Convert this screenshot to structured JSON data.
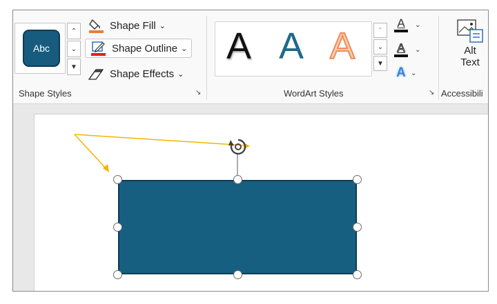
{
  "shape_styles": {
    "sample_label": "Abc",
    "shape_fill_label": "Shape Fill",
    "shape_outline_label": "Shape Outline",
    "shape_effects_label": "Shape Effects",
    "group_label": "Shape Styles"
  },
  "wordart_styles": {
    "samples": [
      "A",
      "A",
      "A"
    ],
    "text_fill_glyph": "A",
    "text_outline_glyph": "A",
    "text_effects_glyph": "A",
    "group_label": "WordArt Styles"
  },
  "accessibility": {
    "alt_label_line1": "Alt",
    "alt_label_line2": "Text",
    "group_label": "Accessibili"
  },
  "colors": {
    "shape_fill": "#175f80",
    "shape_border": "#0e3c55",
    "fill_indicator": "#e67e3a",
    "outline_indicator": "#e02020",
    "wordart_blue": "#1f6a8a",
    "wordart_orange": "#f08a55",
    "arrow": "#f4b400"
  }
}
